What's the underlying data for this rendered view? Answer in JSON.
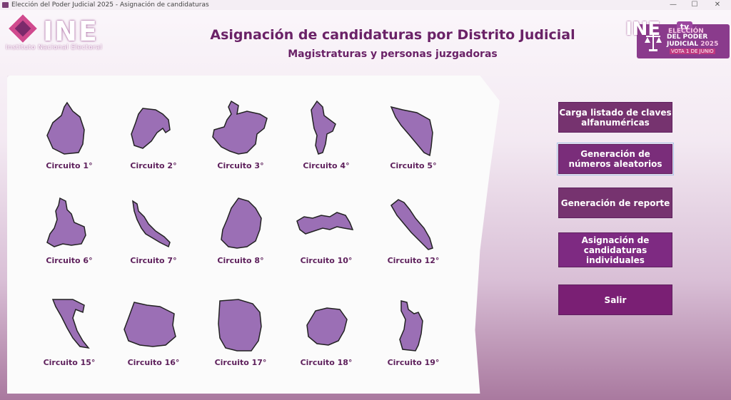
{
  "window": {
    "title": "Elección del Poder Judicial 2025 - Asignación de candidaturas",
    "minimize": "—",
    "maximize": "☐",
    "close": "✕"
  },
  "logo": {
    "name": "INE",
    "subtitle": "Instituto Nacional Electoral"
  },
  "header": {
    "title": "Asignación de candidaturas por Distrito Judicial",
    "subtitle": "Magistraturas y personas juzgadoras"
  },
  "election_logo": {
    "brand": "INE",
    "tv": "tv",
    "line1": "ELECCIÓN",
    "line2": "DEL PODER",
    "line3": "JUDICIAL",
    "year": "2025",
    "line4": "VOTA 1 DE JUNIO"
  },
  "circuits": [
    {
      "label": "Circuito 1°",
      "icon": "circuit-1-map-icon"
    },
    {
      "label": "Circuito 2°",
      "icon": "circuit-2-map-icon"
    },
    {
      "label": "Circuito 3°",
      "icon": "circuit-3-map-icon"
    },
    {
      "label": "Circuito 4°",
      "icon": "circuit-4-map-icon"
    },
    {
      "label": "Circuito 5°",
      "icon": "circuit-5-map-icon"
    },
    {
      "label": "Circuito 6°",
      "icon": "circuit-6-map-icon"
    },
    {
      "label": "Circuito 7°",
      "icon": "circuit-7-map-icon"
    },
    {
      "label": "Circuito 8°",
      "icon": "circuit-8-map-icon"
    },
    {
      "label": "Circuito 10°",
      "icon": "circuit-10-map-icon"
    },
    {
      "label": "Circuito 12°",
      "icon": "circuit-12-map-icon"
    },
    {
      "label": "Circuito 15°",
      "icon": "circuit-15-map-icon"
    },
    {
      "label": "Circuito 16°",
      "icon": "circuit-16-map-icon"
    },
    {
      "label": "Circuito 17°",
      "icon": "circuit-17-map-icon"
    },
    {
      "label": "Circuito 18°",
      "icon": "circuit-18-map-icon"
    },
    {
      "label": "Circuito 19°",
      "icon": "circuit-19-map-icon"
    }
  ],
  "actions": {
    "load_keys": "Carga listado de claves alfanuméricas",
    "random_numbers": "Generación de números aleatorios",
    "report": "Generación de reporte",
    "individual": "Asignación de candidaturas individuales",
    "exit": "Salir"
  },
  "colors": {
    "accent": "#7a2d7a",
    "title": "#6a2267",
    "map_fill": "#9b6fb5"
  }
}
